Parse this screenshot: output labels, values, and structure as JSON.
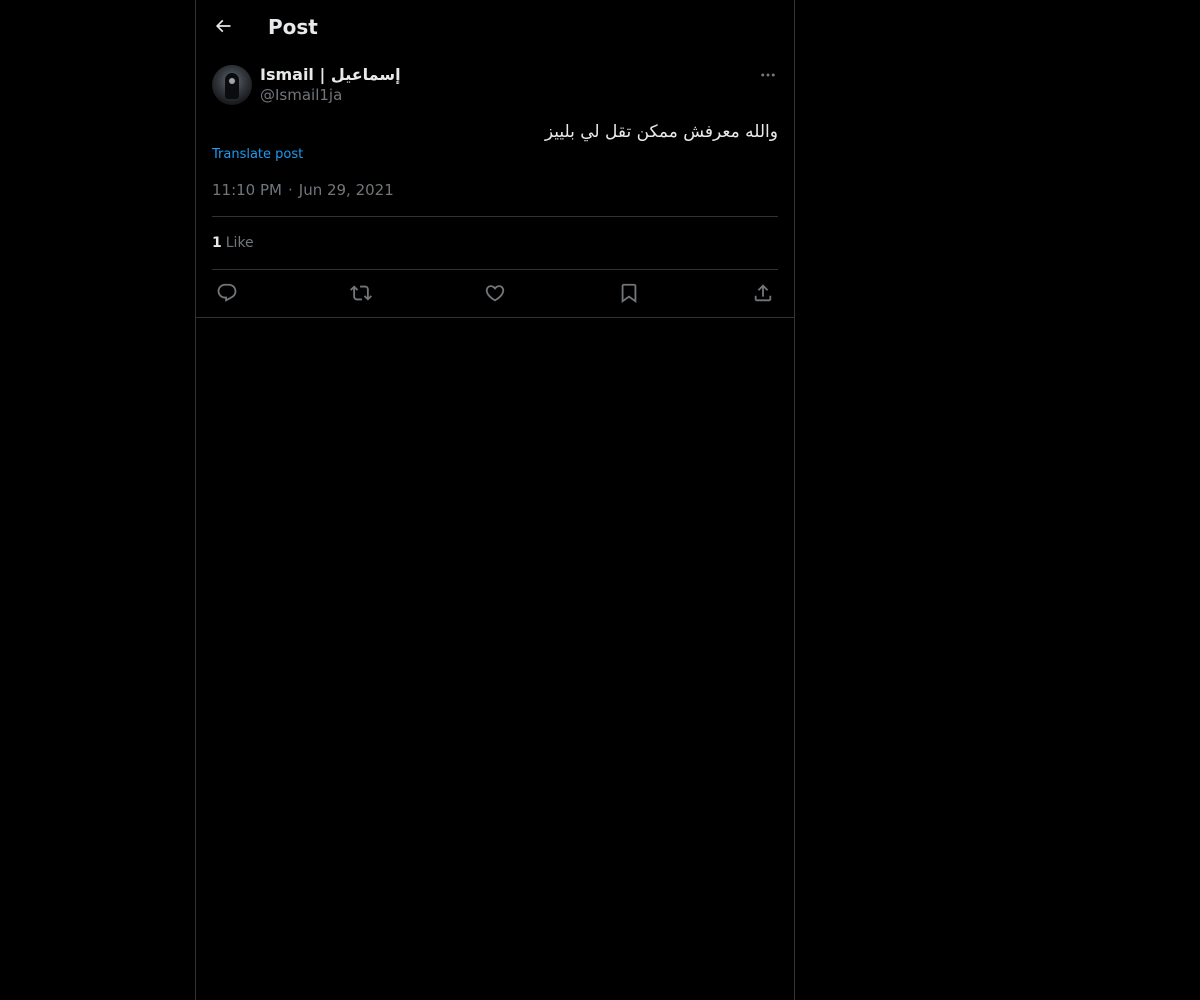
{
  "header": {
    "title": "Post",
    "back_icon": "arrow-left-icon"
  },
  "author": {
    "display_name": "Ismail | إسماعيل",
    "handle": "@Ismail1ja",
    "avatar_icon": "avatar-image"
  },
  "post": {
    "text": "والله معرفش ممكن تقل لي بلييز",
    "translate_label": "Translate post",
    "time": "11:10 PM",
    "separator": "·",
    "date": "Jun 29, 2021"
  },
  "stats": {
    "likes_count": "1",
    "likes_label": "Like"
  },
  "actions": [
    {
      "name": "reply",
      "icon": "reply-icon"
    },
    {
      "name": "repost",
      "icon": "repost-icon"
    },
    {
      "name": "like",
      "icon": "heart-icon"
    },
    {
      "name": "bookmark",
      "icon": "bookmark-icon"
    },
    {
      "name": "share",
      "icon": "share-icon"
    }
  ],
  "colors": {
    "background": "#000000",
    "text_primary": "#e7e9ea",
    "text_secondary": "#71767b",
    "link": "#1d9bf0",
    "border": "#2f3336"
  }
}
